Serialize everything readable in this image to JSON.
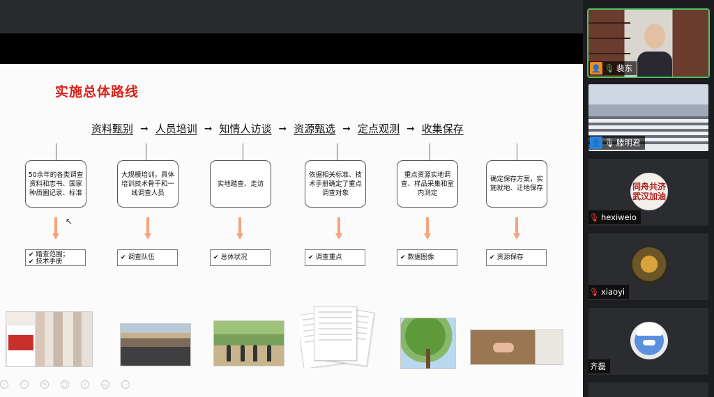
{
  "slide": {
    "title": "实施总体路线",
    "flow_steps": [
      "资料甄别",
      "人员培训",
      "知情人访谈",
      "资源甄选",
      "定点观测",
      "收集保存"
    ],
    "flow_arrow": "➞",
    "cards": [
      "50余年的各类调查资料和志书、国家种质圃记录、标准",
      "大规模培训，具体培训技术骨干和一线调查人员",
      "实地踏查、走访",
      "依据相关标准、技术手册确定了重点调查对象",
      "重点资源实地调查、样品采集和室内测定",
      "确定保存方案，实施就地、迁地保存"
    ],
    "tags": [
      [
        "踏查范围；",
        "技术手册"
      ],
      [
        "调查队伍"
      ],
      [
        "总体状况"
      ],
      [
        "调查重点"
      ],
      [
        "数据图像"
      ],
      [
        "资源保存"
      ]
    ],
    "check_glyph": "✔",
    "title_color": "#d8241c",
    "arrow_color": "#f4a37c"
  },
  "participants": [
    {
      "name": "裴东",
      "role_icon": "person-orange",
      "mic": "active"
    },
    {
      "name": "滕明君",
      "role_icon": "person-blue",
      "mic": "on"
    },
    {
      "name": "hexiweio",
      "mic": "muted",
      "avatar_text": "同舟共济 武汉加油"
    },
    {
      "name": "xiaoyi",
      "mic": "muted"
    },
    {
      "name": "齐磊"
    }
  ],
  "icons": {
    "user": "👤",
    "mic": "🎙",
    "mic_muted": "🎙"
  }
}
